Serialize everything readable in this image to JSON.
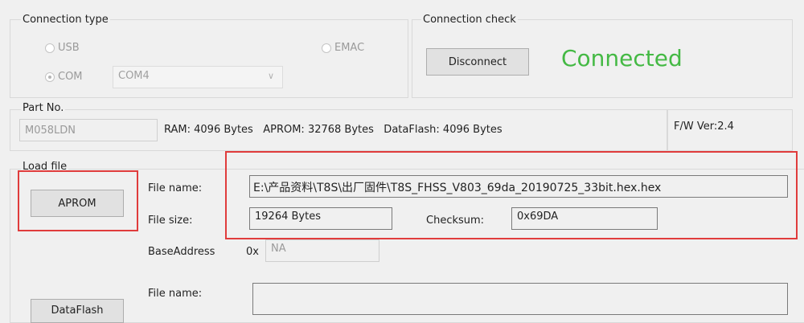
{
  "connection": {
    "label": "Connection type",
    "usb": "USB",
    "emac": "EMAC",
    "com": "COM",
    "com_port": "COM4"
  },
  "check": {
    "label": "Connection check",
    "disconnect": "Disconnect",
    "status": "Connected",
    "status_color": "#44b944"
  },
  "part": {
    "label": "Part No.",
    "value": "M058LDN",
    "info": "RAM: 4096 Bytes   APROM: 32768 Bytes   DataFlash: 4096 Bytes",
    "fw": "F/W Ver:2.4"
  },
  "load": {
    "label": "Load file",
    "aprom_button": "APROM",
    "file_name_label": "File name:",
    "file_name": "E:\\产品资料\\T8S\\出厂固件\\T8S_FHSS_V803_69da_20190725_33bit.hex.hex",
    "file_size_label": "File size:",
    "file_size": "19264 Bytes",
    "checksum_label": "Checksum:",
    "checksum": "0x69DA",
    "base_label": "BaseAddress",
    "base_prefix": "0x",
    "base_value": "NA",
    "file_name_label2": "File name:",
    "dataflash_button": "DataFlash"
  },
  "highlight_color": "#e03c3c"
}
